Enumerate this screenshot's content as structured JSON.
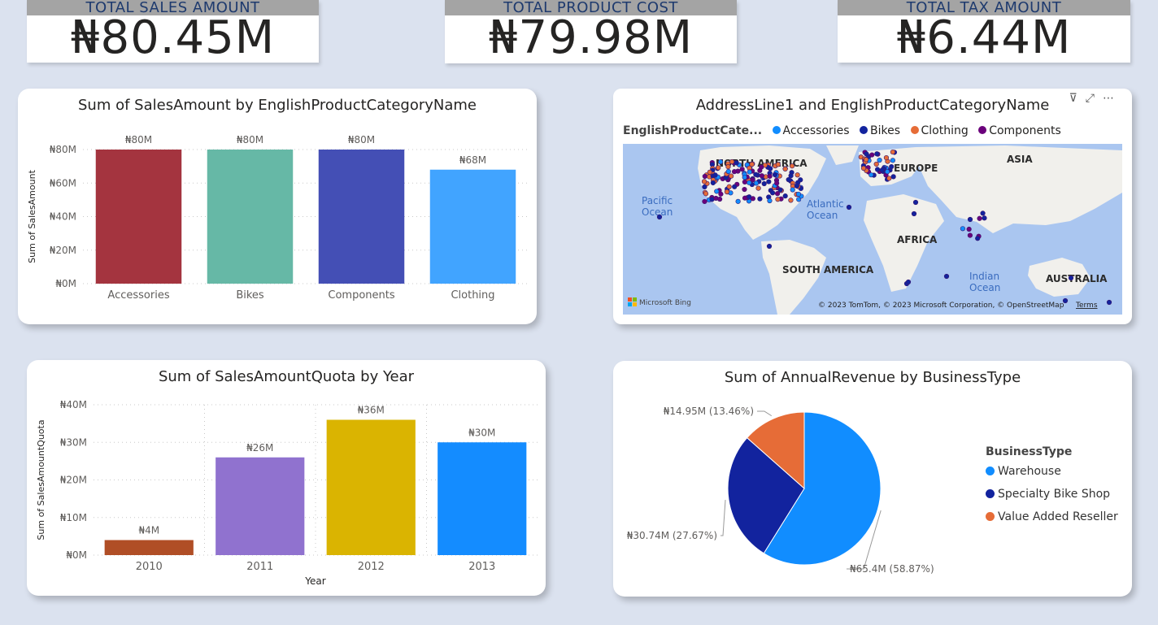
{
  "kpis": {
    "sales": {
      "label": "TOTAL SALES AMOUNT",
      "value": "₦80.45M"
    },
    "cost": {
      "label": "TOTAL PRODUCT COST",
      "value": "₦79.98M"
    },
    "tax": {
      "label": "TOTAL TAX AMOUNT",
      "value": "₦6.44M"
    }
  },
  "map_card": {
    "title": "AddressLine1 and EnglishProductCategoryName",
    "legend_title": "EnglishProductCate...",
    "legend": [
      {
        "name": "Accessories",
        "color": "#118dff"
      },
      {
        "name": "Bikes",
        "color": "#12239e"
      },
      {
        "name": "Clothing",
        "color": "#e66c37"
      },
      {
        "name": "Components",
        "color": "#6b007b"
      }
    ],
    "labels": {
      "north_america": "NORTH AMERICA",
      "europe": "EUROPE",
      "asia": "ASIA",
      "africa": "AFRICA",
      "south_america": "SOUTH AMERICA",
      "australia": "AUSTRALIA",
      "pacific": "Pacific\nOcean",
      "atlantic": "Atlantic\nOcean",
      "indian": "Indian\nOcean"
    },
    "bing": "Microsoft Bing",
    "copyright": "© 2023 TomTom, © 2023 Microsoft Corporation, © OpenStreetMap",
    "terms": "Terms",
    "icons": [
      "filter-icon",
      "focus-mode-icon",
      "more-options-icon"
    ]
  },
  "pie_legend": {
    "title": "BusinessType"
  },
  "chart_data": [
    {
      "type": "bar",
      "title": "Sum of SalesAmount by EnglishProductCategoryName",
      "xlabel": "",
      "ylabel": "Sum of SalesAmount",
      "categories": [
        "Accessories",
        "Bikes",
        "Components",
        "Clothing"
      ],
      "values": [
        80,
        80,
        80,
        68
      ],
      "data_labels": [
        "₦80M",
        "₦80M",
        "₦80M",
        "₦68M"
      ],
      "colors": [
        "#a4343f",
        "#66b8a6",
        "#444fb5",
        "#41a4ff"
      ],
      "ylim": [
        0,
        80
      ],
      "yticks": [
        0,
        20,
        40,
        60,
        80
      ],
      "ytick_labels": [
        "₦0M",
        "₦20M",
        "₦40M",
        "₦60M",
        "₦80M"
      ],
      "grid": true
    },
    {
      "type": "bar",
      "title": "Sum of SalesAmountQuota by Year",
      "xlabel": "Year",
      "ylabel": "Sum of SalesAmountQuota",
      "categories": [
        "2010",
        "2011",
        "2012",
        "2013"
      ],
      "values": [
        4,
        26,
        36,
        30
      ],
      "data_labels": [
        "₦4M",
        "₦26M",
        "₦36M",
        "₦30M"
      ],
      "colors": [
        "#b04e26",
        "#9072cf",
        "#dab401",
        "#148cff"
      ],
      "ylim": [
        0,
        40
      ],
      "yticks": [
        0,
        10,
        20,
        30,
        40
      ],
      "ytick_labels": [
        "₦0M",
        "₦10M",
        "₦20M",
        "₦30M",
        "₦40M"
      ],
      "grid": true
    },
    {
      "type": "pie",
      "title": "Sum of AnnualRevenue by BusinessType",
      "legend_position": "right",
      "slices": [
        {
          "name": "Warehouse",
          "value": 65.4,
          "percent": 58.87,
          "label": "₦65.4M (58.87%)",
          "color": "#118dff"
        },
        {
          "name": "Specialty Bike Shop",
          "value": 30.74,
          "percent": 27.67,
          "label": "₦30.74M (27.67%)",
          "color": "#12239e"
        },
        {
          "name": "Value Added Reseller",
          "value": 14.95,
          "percent": 13.46,
          "label": "₦14.95M (13.46%)",
          "color": "#e66c37"
        }
      ]
    }
  ]
}
